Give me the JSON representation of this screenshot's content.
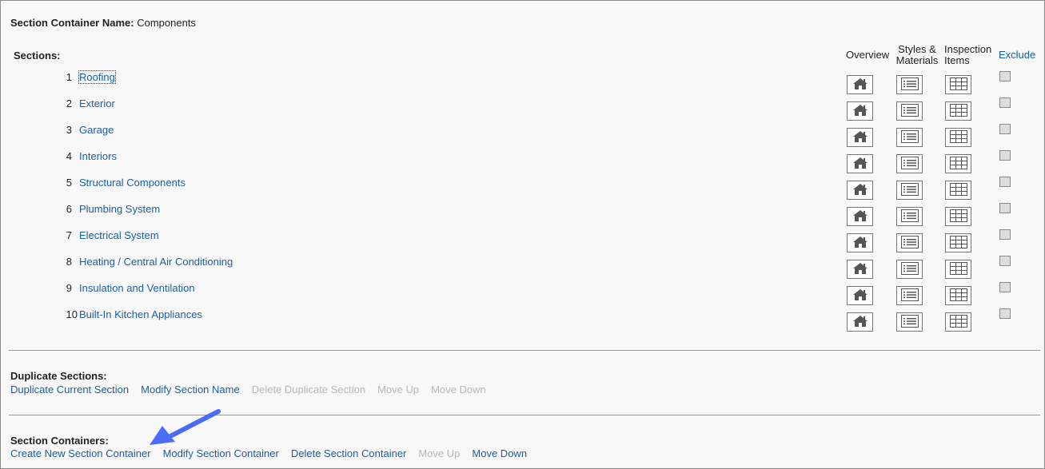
{
  "header": {
    "container_name_label": "Section Container Name:",
    "container_name_value": "Components"
  },
  "sections_label": "Sections:",
  "columns": {
    "overview": "Overview",
    "styles_line1": "Styles &",
    "styles_line2": "Materials",
    "inspection_line1": "Inspection",
    "inspection_line2": "Items",
    "exclude": "Exclude"
  },
  "sections": [
    {
      "num": "1",
      "name": "Roofing",
      "excluded": false
    },
    {
      "num": "2",
      "name": "Exterior",
      "excluded": false
    },
    {
      "num": "3",
      "name": "Garage",
      "excluded": false
    },
    {
      "num": "4",
      "name": "Interiors",
      "excluded": false
    },
    {
      "num": "5",
      "name": "Structural Components",
      "excluded": false
    },
    {
      "num": "6",
      "name": "Plumbing System",
      "excluded": false
    },
    {
      "num": "7",
      "name": "Electrical System",
      "excluded": false
    },
    {
      "num": "8",
      "name": "Heating / Central Air Conditioning",
      "excluded": false
    },
    {
      "num": "9",
      "name": "Insulation and Ventilation",
      "excluded": false
    },
    {
      "num": "10",
      "name": "Built-In Kitchen Appliances",
      "excluded": false
    }
  ],
  "duplicate_sections": {
    "label": "Duplicate Sections:",
    "links": [
      {
        "label": "Duplicate Current Section",
        "enabled": true
      },
      {
        "label": "Modify Section Name",
        "enabled": true
      },
      {
        "label": "Delete Duplicate Section",
        "enabled": false
      },
      {
        "label": "Move Up",
        "enabled": false
      },
      {
        "label": "Move Down",
        "enabled": false
      }
    ]
  },
  "section_containers": {
    "label": "Section Containers:",
    "links": [
      {
        "label": "Create New Section Container",
        "enabled": true
      },
      {
        "label": "Modify Section Container",
        "enabled": true
      },
      {
        "label": "Delete Section Container",
        "enabled": true
      },
      {
        "label": "Move Up",
        "enabled": false
      },
      {
        "label": "Move Down",
        "enabled": true
      }
    ]
  },
  "icons": {
    "overview": "home-icon",
    "styles": "list-icon",
    "inspection": "grid-icon",
    "pointer": "blue-arrow-annotation"
  },
  "colors": {
    "link": "#1a5ea8",
    "disabled": "#b8b8b8",
    "arrow": "#4a6cf7"
  }
}
